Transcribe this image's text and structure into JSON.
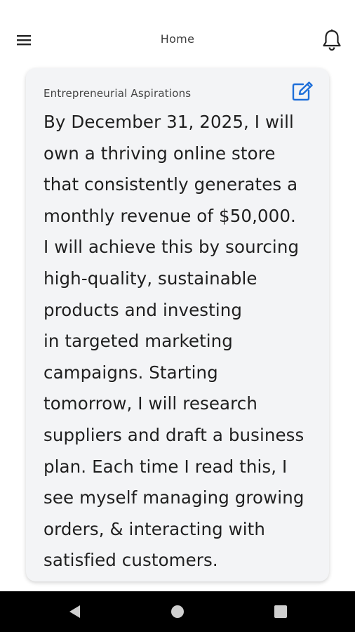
{
  "header": {
    "title": "Home",
    "menu_icon": "hamburger-menu-icon",
    "bell_icon": "bell-icon"
  },
  "card": {
    "title": "Entrepreneurial Aspirations",
    "edit_icon": "edit-pencil-icon",
    "body": "By December 31, 2025, I will\nown a thriving online store\nthat consistently generates a\nmonthly revenue of $50,000.\nI will achieve this by sourcing\nhigh-quality, sustainable\nproducts and investing\nin targeted marketing\ncampaigns. Starting\ntomorrow, I will research\nsuppliers and draft a business\nplan. Each time I read this, I\nsee myself managing growing\norders, & interacting with\nsatisfied customers."
  },
  "navbar": {
    "back_icon": "back-triangle-icon",
    "home_icon": "home-circle-icon",
    "recents_icon": "recents-square-icon"
  },
  "colors": {
    "accent": "#1e6fd9",
    "card_background": "#f3f4f6",
    "navbar_background": "#000000"
  }
}
